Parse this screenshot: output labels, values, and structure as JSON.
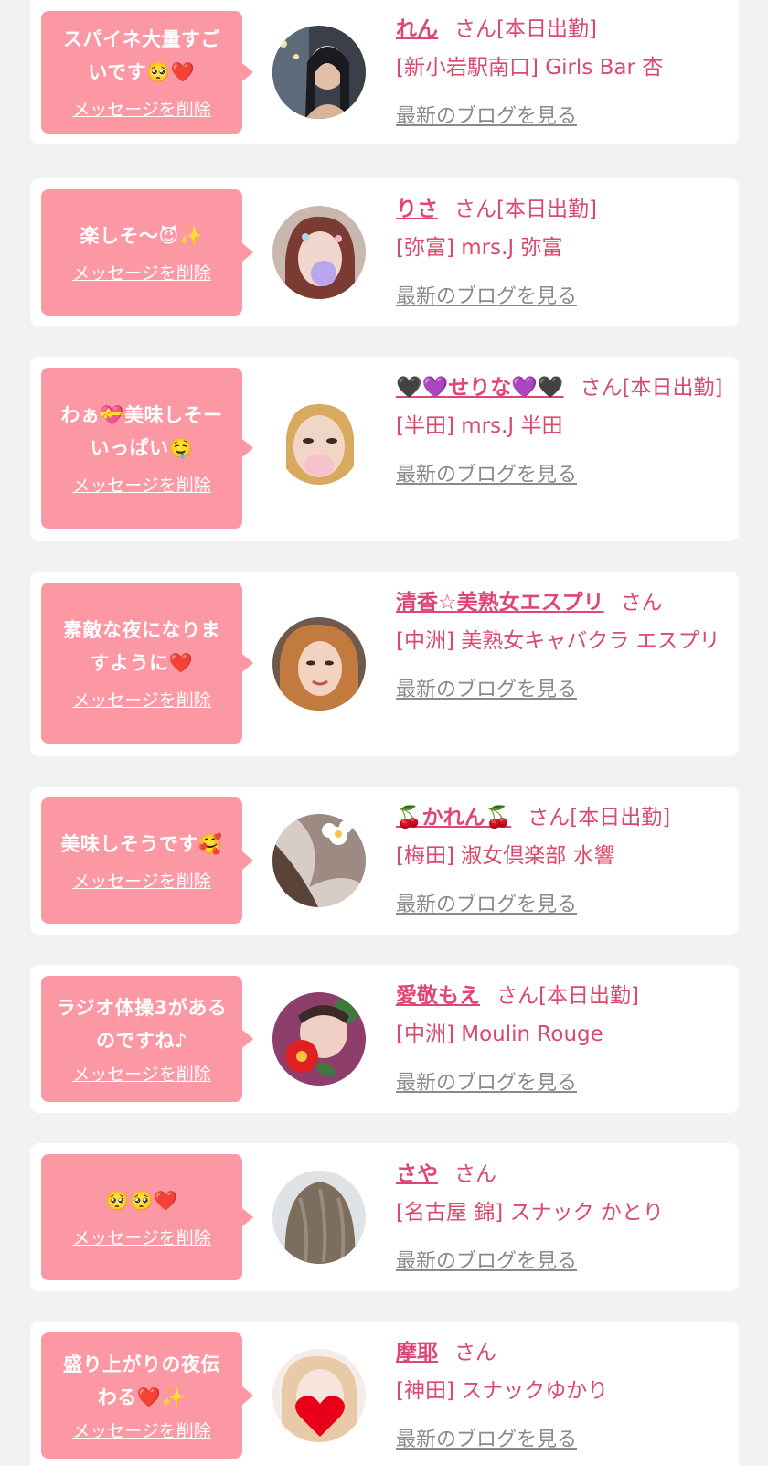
{
  "delete_label": "メッセージを削除",
  "blog_label": "最新のブログを見る",
  "cards": [
    {
      "message": [
        "スパイネ大量すご",
        "いです🥺❤️"
      ],
      "name": "れん",
      "suffix": "さん[本日出勤]",
      "shop": "[新小岩駅南口] Girls Bar 杏"
    },
    {
      "message": [
        "楽しそ〜😈✨"
      ],
      "name": "りさ",
      "suffix": "さん[本日出勤]",
      "shop": "[弥富] mrs.J 弥富"
    },
    {
      "message": [
        "わぁ💝美味しそー",
        "いっぱい🤤"
      ],
      "name": "🖤💜せりな💜🖤",
      "suffix": "さん[本日出勤]",
      "shop": "[半田] mrs.J 半田"
    },
    {
      "message": [
        "素敵な夜になりま",
        "すように❤️"
      ],
      "name": "清香☆美熟女エスプリ",
      "suffix": "さん",
      "shop": "[中洲] 美熟女キャバクラ エスプリ"
    },
    {
      "message": [
        "美味しそうです🥰"
      ],
      "name": "🍒かれん🍒",
      "suffix": "さん[本日出勤]",
      "shop": "[梅田] 淑女倶楽部 水響"
    },
    {
      "message": [
        "ラジオ体操3がある",
        "のですね♪"
      ],
      "name": "愛敬もえ",
      "suffix": "さん[本日出勤]",
      "shop": "[中洲] Moulin Rouge"
    },
    {
      "message": [
        "🥺🥺❤️"
      ],
      "name": "さや",
      "suffix": "さん",
      "shop": "[名古屋 錦] スナック かとり"
    },
    {
      "message": [
        "盛り上がりの夜伝",
        "わる❤️✨"
      ],
      "name": "摩耶",
      "suffix": "さん",
      "shop": "[神田] スナックゆかり"
    }
  ],
  "colors": {
    "background": "#f2f2f2",
    "bubble": "#fc97a4",
    "name": "#e04673",
    "text": "#d94a6c",
    "link_gray": "#8a8a8a"
  }
}
